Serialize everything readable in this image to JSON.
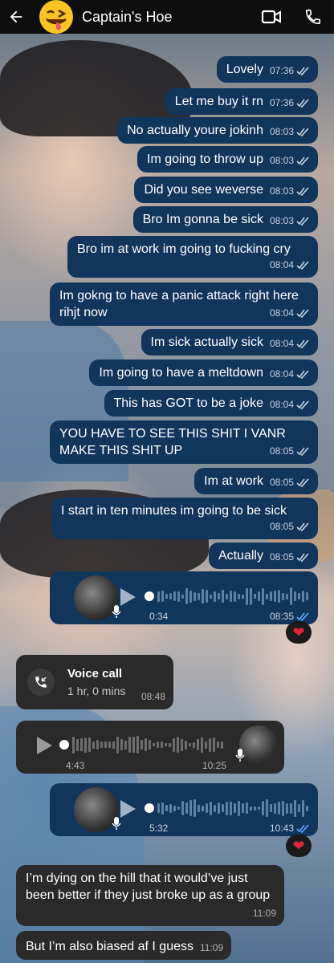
{
  "header": {
    "contact_name": "Captain's Hoe",
    "avatar_emoji": "😝",
    "icons": [
      "back-arrow-icon",
      "video-call-icon",
      "phone-icon"
    ]
  },
  "messages": [
    {
      "text": "Lovely",
      "time": "07:36"
    },
    {
      "text": "Let me buy it rn",
      "time": "07:36"
    },
    {
      "text": "No actually youre jokinh",
      "time": "08:03"
    },
    {
      "text": "Im going to throw up",
      "time": "08:03"
    },
    {
      "text": "Did you see weverse",
      "time": "08:03"
    },
    {
      "text": "Bro Im gonna be sick",
      "time": "08:03"
    },
    {
      "text": "Bro im at work im going to fucking cry",
      "time": "08:04"
    },
    {
      "text": "Im gokng to have a panic attack right here rihjt now",
      "time": "08:04"
    },
    {
      "text": "Im sick actually sick",
      "time": "08:04"
    },
    {
      "text": "Im going to have a meltdown",
      "time": "08:04"
    },
    {
      "text": "This has GOT to be a joke",
      "time": "08:04"
    },
    {
      "text": "YOU HAVE TO SEE THIS SHIT I VANR MAKE THIS SHIT UP",
      "time": "08:05"
    },
    {
      "text": "Im at work",
      "time": "08:05"
    },
    {
      "text": "I start in ten minutes im going to be sick",
      "time": "08:05"
    },
    {
      "text": "Actually",
      "time": "08:05"
    }
  ],
  "voice1": {
    "duration": "0:34",
    "time": "08:35"
  },
  "reaction": "❤",
  "call": {
    "title": "Voice call",
    "duration": "1 hr, 0 mins",
    "time": "08:48"
  },
  "voice2": {
    "duration": "4:43",
    "time": "10:25"
  },
  "voice3": {
    "duration": "5:32",
    "time": "10:43"
  },
  "incoming": [
    {
      "text": "I’m dying on the hill that it would’ve just been better if they just broke up as a group",
      "time": "11:09"
    },
    {
      "text": "But I’m also biased af I guess",
      "time": "11:09"
    }
  ],
  "colors": {
    "outgoing": "#12355c",
    "incoming": "#2a2a2a",
    "read_ticks": "#5aa7ff",
    "header": "#0e0e0e"
  }
}
